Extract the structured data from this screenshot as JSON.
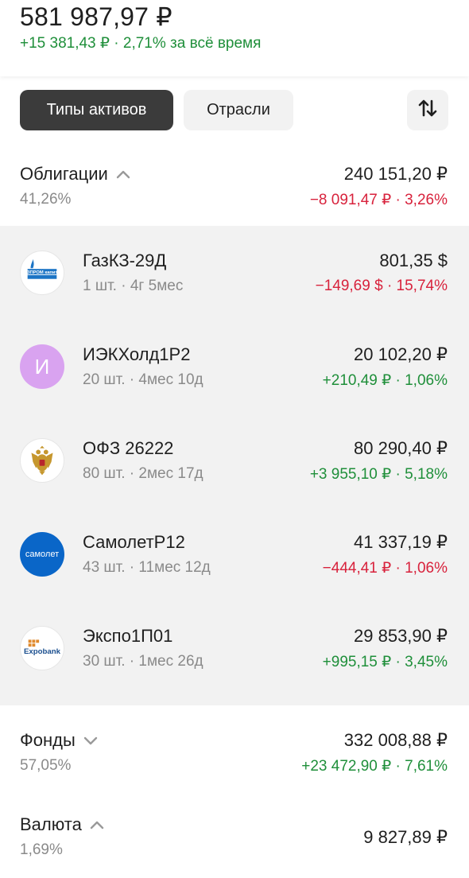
{
  "portfolio": {
    "total": "581 987,97 ₽",
    "change": "+15 381,43 ₽ · 2,71%",
    "change_period": "за всё время"
  },
  "tabs": [
    {
      "label": "Типы активов",
      "active": true
    },
    {
      "label": "Отрасли",
      "active": false
    }
  ],
  "sort_icon": "sort-arrows-icon",
  "groups": [
    {
      "title": "Облигации",
      "expanded": true,
      "percent": "41,26%",
      "value": "240 151,20 ₽",
      "change": "−8 091,47 ₽ · 3,26%",
      "items": [
        {
          "name": "ГазКЗ-29Д",
          "meta": "1 шт. · 4г 5мес",
          "value": "801,35 $",
          "change": "−149,69 $ · 15,74%",
          "logo": "gazprom-logo",
          "logo_text": "ГАЗПРОМ капитал"
        },
        {
          "name": "ИЭКХолд1Р2",
          "meta": "20 шт. · 4мес 10д",
          "value": "20 102,20 ₽",
          "change": "+210,49 ₽ · 1,06%",
          "logo": "letter-avatar",
          "logo_text": "И"
        },
        {
          "name": "ОФЗ 26222",
          "meta": "80 шт. · 2мес 17д",
          "value": "80 290,40 ₽",
          "change": "+3 955,10 ₽ · 5,18%",
          "logo": "russian-coat-of-arms"
        },
        {
          "name": "СамолетР12",
          "meta": "43 шт. · 11мес 12д",
          "value": "41 337,19 ₽",
          "change": "−444,41 ₽ · 1,06%",
          "logo": "samolet-logo",
          "logo_text": "самолет"
        },
        {
          "name": "Экспо1П01",
          "meta": "30 шт. · 1мес 26д",
          "value": "29 853,90 ₽",
          "change": "+995,15 ₽ · 3,45%",
          "logo": "expobank-logo",
          "logo_text": "Expobank"
        }
      ]
    },
    {
      "title": "Фонды",
      "expanded": false,
      "percent": "57,05%",
      "value": "332 008,88 ₽",
      "change": "+23 472,90 ₽ · 7,61%"
    },
    {
      "title": "Валюта",
      "expanded": true,
      "percent": "1,69%",
      "value": "9 827,89 ₽"
    }
  ],
  "colors": {
    "positive": "#1f8f3a",
    "negative": "#d8223c",
    "muted": "#8a8a8a",
    "active_tab": "#3b3b3b",
    "surface": "#f2f2f2",
    "avatar_purple": "#d9a3f0",
    "samolet_blue": "#0a66c8"
  }
}
